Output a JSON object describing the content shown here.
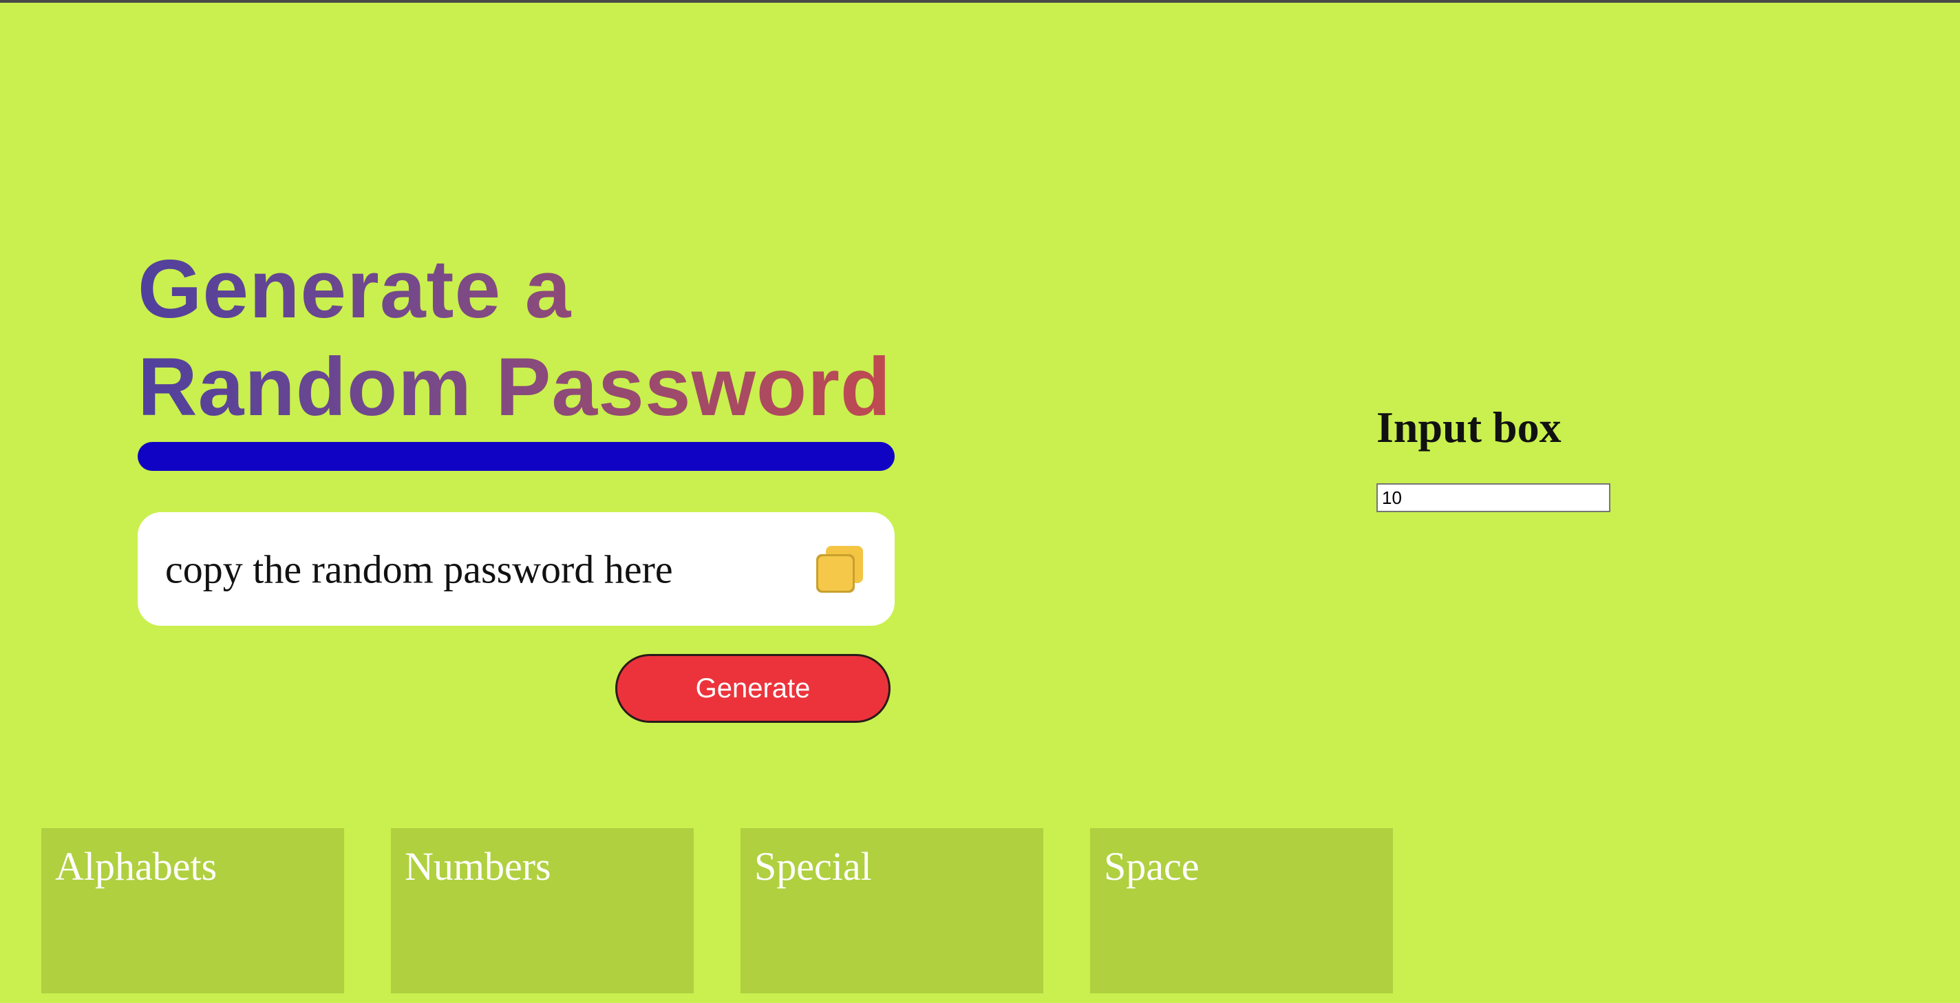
{
  "header": {
    "title_line1": "Generate a",
    "title_line2": "Random Password"
  },
  "password": {
    "placeholder_text": "copy the random password here",
    "copy_icon": "copy-icon"
  },
  "actions": {
    "generate_label": "Generate"
  },
  "length": {
    "heading": "Input box",
    "value": "10"
  },
  "options": [
    {
      "label": "Alphabets"
    },
    {
      "label": "Numbers"
    },
    {
      "label": "Special"
    },
    {
      "label": "Space"
    }
  ],
  "colors": {
    "background": "#c9f04e",
    "accent_bar": "#1003c4",
    "generate_button": "#ec333b",
    "copy_icon": "#f4c542",
    "option_card": "#b0d040",
    "title_gradient_start": "#50409e",
    "title_gradient_end": "#c04a50"
  }
}
